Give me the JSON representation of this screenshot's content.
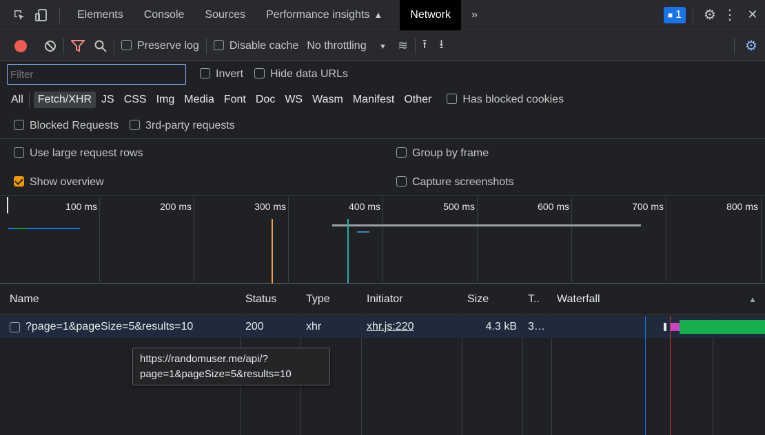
{
  "tabs": {
    "items": [
      "Elements",
      "Console",
      "Sources",
      "Performance insights",
      "Network"
    ],
    "more": "»",
    "issues_count": "1",
    "close": "✕"
  },
  "toolbar": {
    "preserve_log": "Preserve log",
    "disable_cache": "Disable cache",
    "throttling": "No throttling"
  },
  "filter": {
    "placeholder": "Filter",
    "invert": "Invert",
    "hide_data_urls": "Hide data URLs"
  },
  "types": {
    "items": [
      "All",
      "Fetch/XHR",
      "JS",
      "CSS",
      "Img",
      "Media",
      "Font",
      "Doc",
      "WS",
      "Wasm",
      "Manifest",
      "Other"
    ],
    "selected": "Fetch/XHR",
    "has_blocked_cookies": "Has blocked cookies"
  },
  "blocked": {
    "blocked_requests": "Blocked Requests",
    "third_party": "3rd-party requests"
  },
  "settings": {
    "large_rows": "Use large request rows",
    "group_by_frame": "Group by frame",
    "show_overview": "Show overview",
    "capture_screenshots": "Capture screenshots"
  },
  "overview": {
    "ticks": [
      "100 ms",
      "200 ms",
      "300 ms",
      "400 ms",
      "500 ms",
      "600 ms",
      "700 ms",
      "800 ms"
    ]
  },
  "table": {
    "headers": {
      "name": "Name",
      "status": "Status",
      "type": "Type",
      "initiator": "Initiator",
      "size": "Size",
      "time": "T..",
      "waterfall": "Waterfall"
    },
    "rows": [
      {
        "name": "?page=1&pageSize=5&results=10",
        "status": "200",
        "type": "xhr",
        "initiator": "xhr.js:220",
        "size": "4.3 kB",
        "time": "3…"
      }
    ]
  },
  "tooltip": {
    "line1": "https://randomuser.me/api/?",
    "line2": "page=1&pageSize=5&results=10"
  },
  "colors": {
    "record": "#ee5b50",
    "filter_icon": "#f28b82",
    "accent": "#8ab4f8",
    "checked": "#f29900"
  }
}
